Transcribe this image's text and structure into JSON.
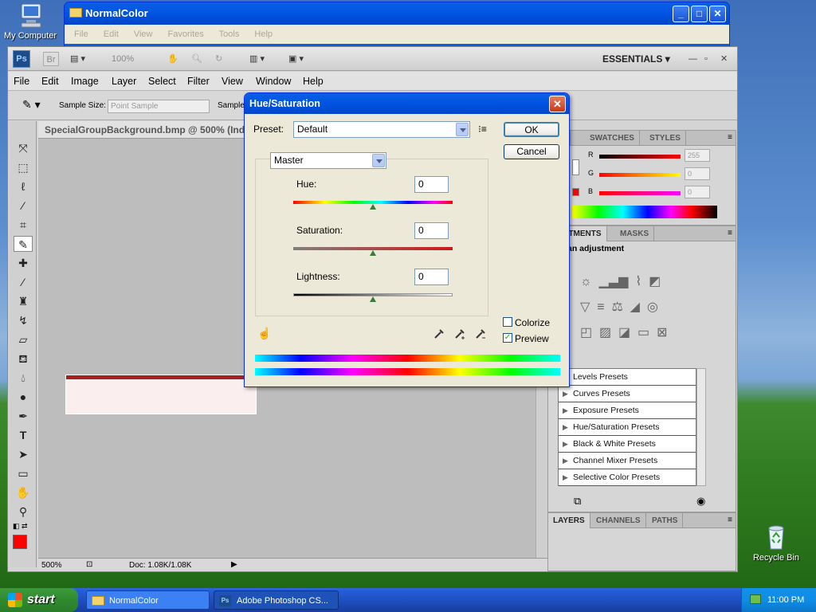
{
  "desktop": {
    "icons": [
      {
        "label": "My Computer",
        "icon": "my-computer-icon"
      },
      {
        "label": "Recycle Bin",
        "icon": "recycle-bin-icon"
      }
    ]
  },
  "explorer": {
    "title": "NormalColor",
    "menu": [
      "File",
      "Edit",
      "View",
      "Favorites",
      "Tools",
      "Help"
    ]
  },
  "photoshop": {
    "appbar": {
      "logo": "Ps",
      "br": "Br",
      "zoom": "100%",
      "workspace": "ESSENTIALS"
    },
    "menu": [
      "File",
      "Edit",
      "Image",
      "Layer",
      "Select",
      "Filter",
      "View",
      "Window",
      "Help"
    ],
    "options": {
      "sample_size_label": "Sample Size:",
      "sample_size_value": "Point Sample",
      "sample_label": "Sample"
    },
    "document": {
      "tab_title": "SpecialGroupBackground.bmp @ 500% (Inde",
      "zoom": "500%",
      "doc_info": "Doc: 1.08K/1.08K"
    },
    "color_panel": {
      "tabs": [
        "OR",
        "SWATCHES",
        "STYLES"
      ],
      "r_label": "R",
      "g_label": "G",
      "b_label": "B",
      "r_value": "255",
      "g_value": "0",
      "b_value": "0"
    },
    "adjustments_panel": {
      "tabs": [
        "JUSTMENTS",
        "MASKS"
      ],
      "header": "an adjustment",
      "presets": [
        "Levels Presets",
        "Curves Presets",
        "Exposure Presets",
        "Hue/Saturation Presets",
        "Black & White Presets",
        "Channel Mixer Presets",
        "Selective Color Presets"
      ]
    },
    "layers_panel": {
      "tabs": [
        "LAYERS",
        "CHANNELS",
        "PATHS"
      ]
    },
    "foreground_color": "#ff0000"
  },
  "dialog": {
    "title": "Hue/Saturation",
    "preset_label": "Preset:",
    "preset_value": "Default",
    "ok_label": "OK",
    "cancel_label": "Cancel",
    "channel_value": "Master",
    "hue_label": "Hue:",
    "hue_value": "0",
    "saturation_label": "Saturation:",
    "saturation_value": "0",
    "lightness_label": "Lightness:",
    "lightness_value": "0",
    "colorize_label": "Colorize",
    "colorize_checked": false,
    "preview_label": "Preview",
    "preview_checked": true
  },
  "taskbar": {
    "start_label": "start",
    "tasks": [
      "NormalColor",
      "Adobe Photoshop CS..."
    ],
    "clock": "11:00 PM"
  }
}
